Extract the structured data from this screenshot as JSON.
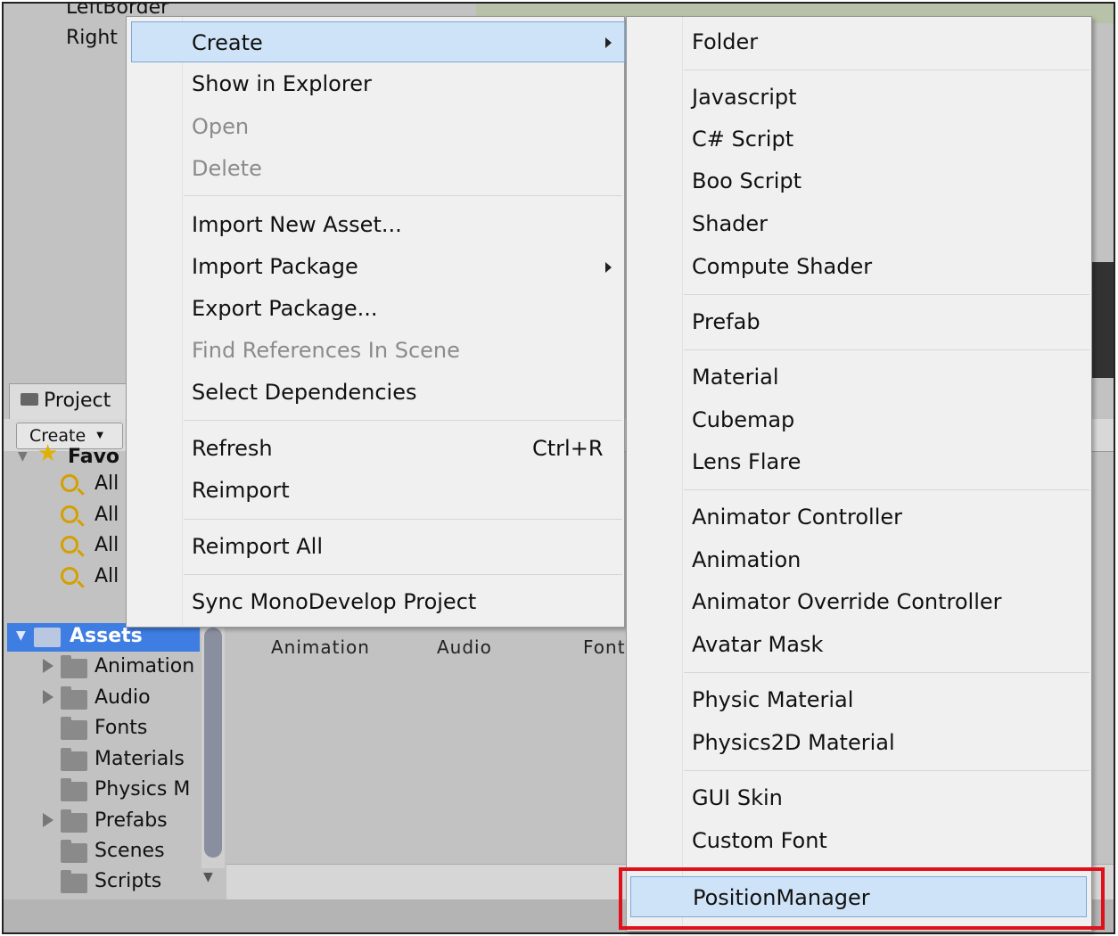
{
  "inspector": {
    "rows": [
      "LeftBorder",
      "Right"
    ]
  },
  "project_panel": {
    "tab_label": "Project",
    "create_button": "Create",
    "favorites_label": "Favo",
    "search_items": [
      "All",
      "All",
      "All",
      "All"
    ],
    "assets_label": "Assets",
    "asset_folders": [
      "Animation",
      "Audio",
      "Fonts",
      "Materials",
      "Physics M",
      "Prefabs",
      "Scenes",
      "Scripts"
    ],
    "grid_headers": [
      "Animation",
      "Audio",
      "Font"
    ]
  },
  "context_menu": {
    "items": [
      {
        "label": "Create",
        "submenu": true,
        "highlighted": true
      },
      {
        "label": "Show in Explorer"
      },
      {
        "label": "Open",
        "disabled": true
      },
      {
        "label": "Delete",
        "disabled": true
      },
      {
        "label": "Import New Asset..."
      },
      {
        "label": "Import Package",
        "submenu": true
      },
      {
        "label": "Export Package..."
      },
      {
        "label": "Find References In Scene",
        "disabled": true
      },
      {
        "label": "Select Dependencies"
      },
      {
        "label": "Refresh",
        "shortcut": "Ctrl+R"
      },
      {
        "label": "Reimport"
      },
      {
        "label": "Reimport All"
      },
      {
        "label": "Sync MonoDevelop Project"
      }
    ]
  },
  "create_submenu": {
    "items": [
      "Folder",
      "Javascript",
      "C# Script",
      "Boo Script",
      "Shader",
      "Compute Shader",
      "Prefab",
      "Material",
      "Cubemap",
      "Lens Flare",
      "Animator Controller",
      "Animation",
      "Animator Override Controller",
      "Avatar Mask",
      "Physic Material",
      "Physics2D Material",
      "GUI Skin",
      "Custom Font",
      "PositionManager"
    ],
    "highlighted": "PositionManager",
    "highlight_color": "#e0101a"
  }
}
